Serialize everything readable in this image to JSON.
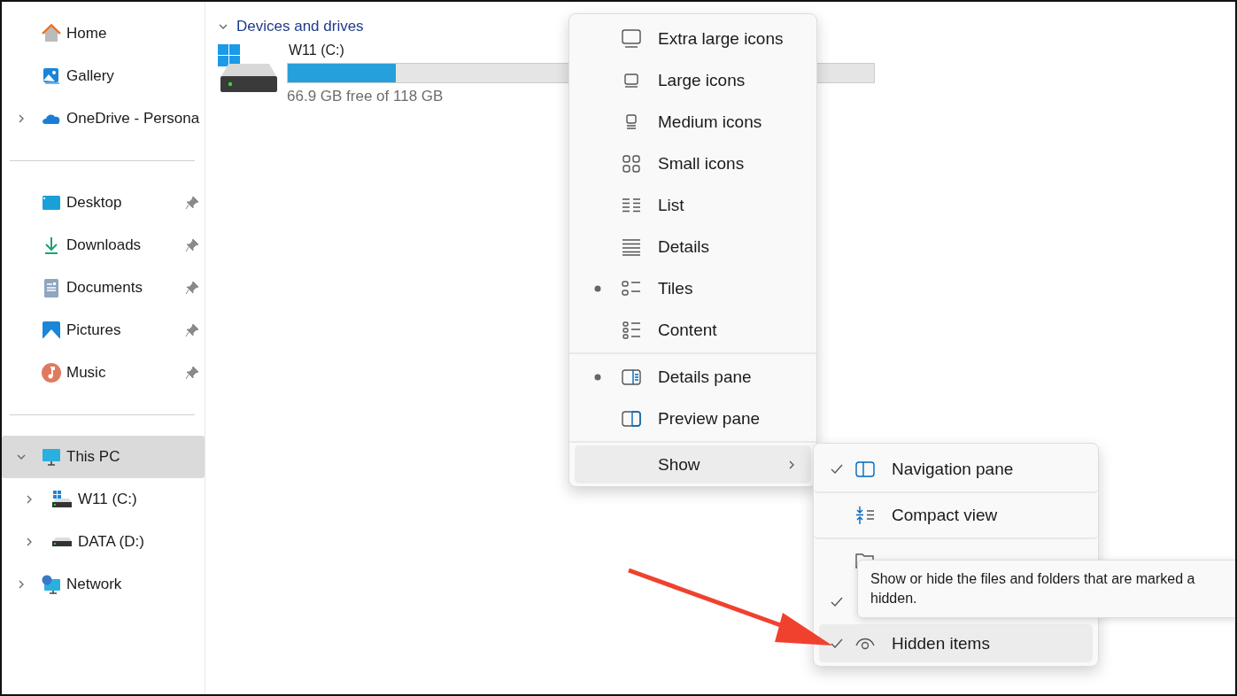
{
  "navigation": {
    "groups": [
      [
        {
          "label": "Home",
          "selected": false,
          "pinned": false
        },
        {
          "label": "Gallery",
          "selected": false,
          "pinned": false
        },
        {
          "label": "OneDrive - Persona",
          "selected": false,
          "pinned": false,
          "expanded": false
        }
      ],
      [
        {
          "label": "Desktop",
          "selected": false,
          "pinned": true
        },
        {
          "label": "Downloads",
          "selected": false,
          "pinned": true
        },
        {
          "label": "Documents",
          "selected": false,
          "pinned": true
        },
        {
          "label": "Pictures",
          "selected": false,
          "pinned": true
        },
        {
          "label": "Music",
          "selected": false,
          "pinned": true
        }
      ],
      [
        {
          "label": "This PC",
          "selected": true,
          "pinned": false,
          "expanded": true,
          "children": [
            {
              "label": "W11 (C:)",
              "selected": false,
              "pinned": false,
              "expanded": false
            },
            {
              "label": "DATA (D:)",
              "selected": false,
              "pinned": false,
              "expanded": false
            }
          ]
        },
        {
          "label": "Network",
          "selected": false,
          "pinned": false,
          "expanded": false
        }
      ]
    ]
  },
  "content": {
    "section": {
      "title": "Devices and drives",
      "expanded": true
    },
    "drives": [
      {
        "name": "W11 (C:)",
        "level": 0.184,
        "free": "66.9 GB free of 118 GB"
      }
    ]
  },
  "view_menu": {
    "items": [
      {
        "label": "Extra large icons",
        "selected": false
      },
      {
        "label": "Large icons",
        "selected": false
      },
      {
        "label": "Medium icons",
        "selected": false
      },
      {
        "label": "Small icons",
        "selected": false
      },
      {
        "label": "List",
        "selected": false
      },
      {
        "label": "Details",
        "selected": false
      },
      {
        "label": "Tiles",
        "selected": true
      },
      {
        "label": "Content",
        "selected": false
      },
      {
        "label": "Details pane",
        "selected": true
      },
      {
        "label": "Preview pane",
        "selected": false
      }
    ],
    "show": {
      "label": "Show",
      "highlighted": true
    }
  },
  "show_menu": {
    "items": [
      {
        "label": "Navigation pane",
        "checked": true,
        "highlighted": false
      },
      {
        "label": "Compact view",
        "checked": false,
        "highlighted": false
      },
      {
        "checked": false,
        "highlighted": false
      },
      {
        "checked": true,
        "highlighted": false
      },
      {
        "label": "Hidden items",
        "checked": true,
        "highlighted": true
      }
    ]
  },
  "tooltip": {
    "lines": [
      "Show or hide the files and folders that are marked a",
      "hidden."
    ]
  }
}
